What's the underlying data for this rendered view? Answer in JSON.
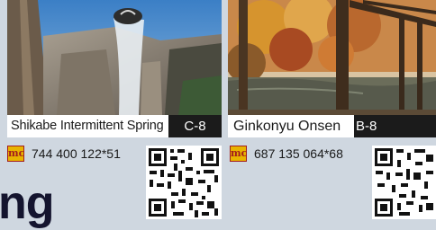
{
  "spots": [
    {
      "name": "Shikabe Intermittent Spring",
      "grid_code": "C-8",
      "mapcode": "744 400 122*51"
    },
    {
      "name": "Ginkonyu Onsen",
      "grid_code": "B-8",
      "mapcode": "687 135 064*68"
    }
  ],
  "mapcode_icon_text": "mc",
  "heading_fragment": "ng",
  "colors": {
    "background": "#cfd7e0",
    "code_badge": "#1b1b1b",
    "mapcode_icon_fill": "#e8b400",
    "mapcode_icon_border": "#a21d1d",
    "heading": "#14142e"
  }
}
